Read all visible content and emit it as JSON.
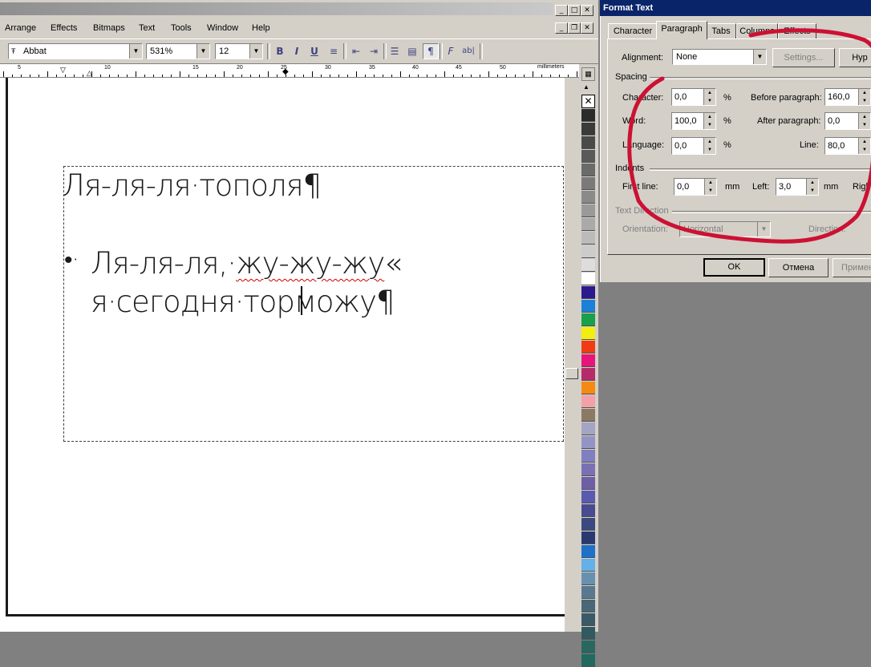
{
  "menu": [
    "Arrange",
    "Effects",
    "Bitmaps",
    "Text",
    "Tools",
    "Window",
    "Help"
  ],
  "toolbar": {
    "font_name": "Abbat",
    "zoom": "531%",
    "font_size": "12",
    "buttons": [
      "B",
      "I",
      "U",
      "¶",
      "F",
      "ab|"
    ]
  },
  "ruler": {
    "unit": "millimeters",
    "numbers": [
      "5",
      "10",
      "15",
      "20",
      "25",
      "30",
      "35",
      "40",
      "45",
      "50"
    ]
  },
  "document": {
    "line1": "Ля-ля-ля·тополя¶",
    "bullet": "•·",
    "line2_a": "Ля-ля-ля,·",
    "line2_b": "жу-жу-жу",
    "line2_c": "«",
    "line3_a": "я·сегодня·тор",
    "line3_b": "можу¶"
  },
  "palette": [
    "#2b2b2b",
    "#3a3a3a",
    "#4a4a4a",
    "#5a5a5a",
    "#6a6a6a",
    "#7a7a7a",
    "#8a8a8a",
    "#9a9a9a",
    "#aaaaaa",
    "#bbbbbb",
    "#cccccc",
    "#dddddd",
    "#ffffff",
    "#2a1a8c",
    "#1c7fd8",
    "#19a04a",
    "#f2ee0e",
    "#f03c12",
    "#e5157a",
    "#b52a6a",
    "#f48a12",
    "#f4a0a8",
    "#8a7a64",
    "#a4a4c4",
    "#9494c4",
    "#8080c0",
    "#7a70b4",
    "#6e5ea6",
    "#5a5ab0",
    "#4a4a90",
    "#3a4a80",
    "#2a3a70",
    "#1e70c8",
    "#64b0e8",
    "#6890b0",
    "#5a7890",
    "#486878",
    "#3a5a68",
    "#305a60",
    "#286860",
    "#206a60"
  ],
  "dialog": {
    "title": "Format Text",
    "tabs": [
      "Character",
      "Paragraph",
      "Tabs",
      "Columns",
      "Effects"
    ],
    "selected_tab": "Paragraph",
    "alignment_label": "Alignment:",
    "alignment_value": "None",
    "settings_button": "Settings...",
    "hyph_button": "Hyp",
    "spacing_group": "Spacing",
    "character_label": "Character:",
    "character_value": "0,0",
    "word_label": "Word:",
    "word_value": "100,0",
    "language_label": "Language:",
    "language_value": "0,0",
    "percent": "%",
    "before_label": "Before paragraph:",
    "before_value": "160,0",
    "after_label": "After paragraph:",
    "after_value": "0,0",
    "line_label": "Line:",
    "line_value": "80,0",
    "indents_group": "Indents",
    "first_line_label": "First line:",
    "first_line_value": "0,0",
    "mm": "mm",
    "left_label": "Left:",
    "left_value": "3,0",
    "right_label": "Righ",
    "direction_group": "Text Direction",
    "orientation_label": "Orientation:",
    "orientation_value": "Horizontal",
    "direction_label": "Direction:",
    "ok_button": "OK",
    "cancel_button": "Отмена",
    "apply_button": "Примен"
  },
  "annotation_color": "#cc1133"
}
